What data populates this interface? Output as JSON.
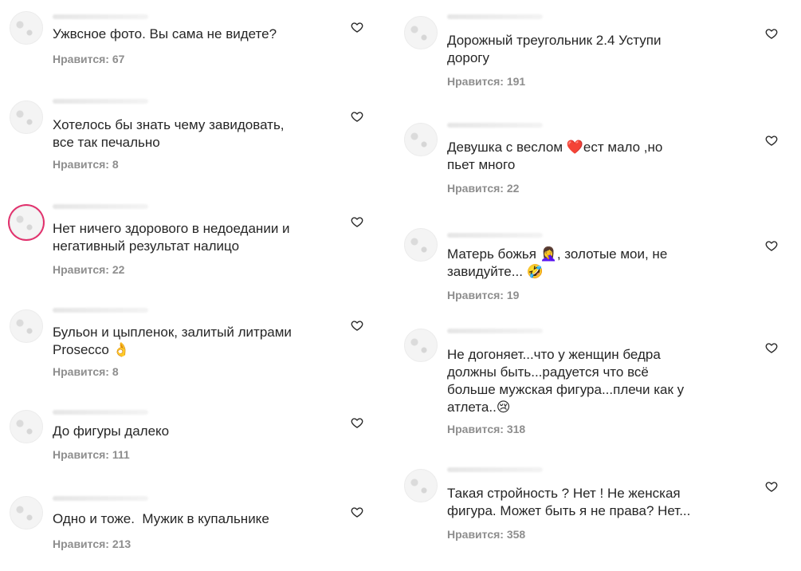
{
  "likes_prefix": "Нравится:",
  "left_column": [
    {
      "text": "Ужвсное фото. Вы сама не видете?",
      "likes": "Нравится: 67"
    },
    {
      "text": "Хотелось бы знать чему завидовать,\nвсе так печально",
      "likes": "Нравится: 8"
    },
    {
      "text": "Нет ничего здорового в недоедании и\nнегативный результат налицо",
      "likes": "Нравится: 22"
    },
    {
      "text": "Бульон и цыпленок, залитый литрами\nProsecco 👌",
      "likes": "Нравится: 8"
    },
    {
      "text": "До фигуры далеко",
      "likes": "Нравится: 111"
    },
    {
      "text": "Одно и тоже.  Мужик в купальнике",
      "likes": "Нравится: 213"
    }
  ],
  "right_column": [
    {
      "text": "Дорожный треугольник 2.4 Уступи\nдорогу",
      "likes": "Нравится: 191"
    },
    {
      "text": "Девушка с веслом ❤️ест мало ,но\nпьет много",
      "likes": "Нравится: 22"
    },
    {
      "text": "Матерь божья 🤦‍♀️, золотые мои, не\nзавидуйте... 🤣",
      "likes": "Нравится: 19"
    },
    {
      "text": "Не догоняет...что у женщин бедра\nдолжны быть...радуется что всё\nбольше мужская фигура...плечи как у\nатлета..😢",
      "likes": "Нравится: 318"
    },
    {
      "text": "Такая стройность ? Нет ! Не женская\nфигура. Может быть я не права? Нет...",
      "likes": "Нравится: 358"
    }
  ],
  "icons": {
    "like": "heart-outline-icon",
    "avatar": "user-avatar"
  }
}
